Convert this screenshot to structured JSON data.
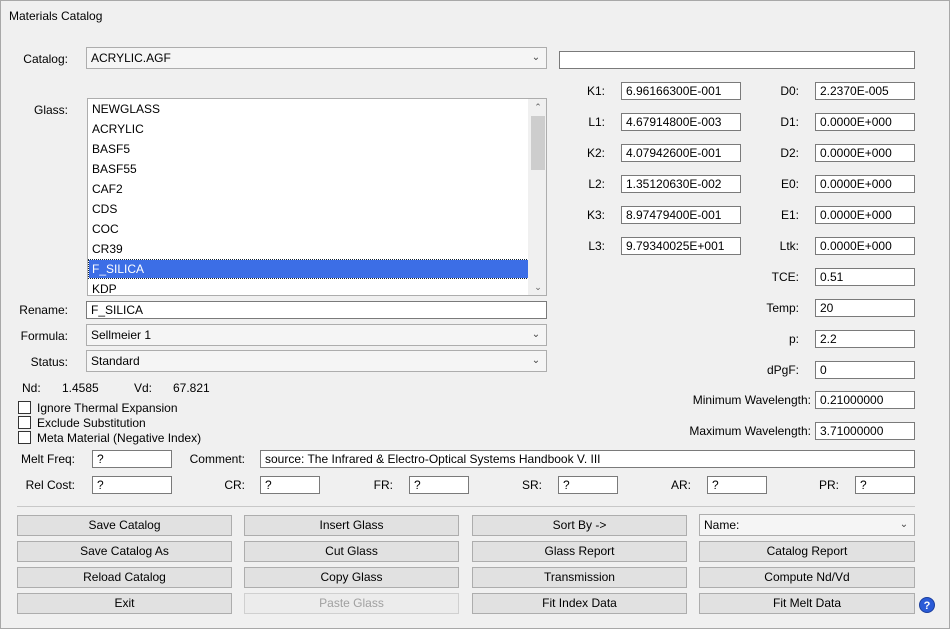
{
  "window": {
    "title": "Materials Catalog"
  },
  "catalog": {
    "label": "Catalog:",
    "value": "ACRYLIC.AGF",
    "extra_value": ""
  },
  "glass": {
    "label": "Glass:",
    "items": [
      "NEWGLASS",
      "ACRYLIC",
      "BASF5",
      "BASF55",
      "CAF2",
      "CDS",
      "COC",
      "CR39",
      "F_SILICA",
      "KDP"
    ],
    "selected": "F_SILICA"
  },
  "rename": {
    "label": "Rename:",
    "value": "F_SILICA"
  },
  "formula": {
    "label": "Formula:",
    "value": "Sellmeier 1"
  },
  "status": {
    "label": "Status:",
    "value": "Standard"
  },
  "indices": {
    "nd_label": "Nd:",
    "nd_value": "1.4585",
    "vd_label": "Vd:",
    "vd_value": "67.821"
  },
  "checkboxes": {
    "ignore_thermal": "Ignore Thermal Expansion",
    "exclude_sub": "Exclude Substitution",
    "meta_material": "Meta Material (Negative Index)"
  },
  "coefficients": {
    "k1": {
      "label": "K1:",
      "value": "6.96166300E-001"
    },
    "l1": {
      "label": "L1:",
      "value": "4.67914800E-003"
    },
    "k2": {
      "label": "K2:",
      "value": "4.07942600E-001"
    },
    "l2": {
      "label": "L2:",
      "value": "1.35120630E-002"
    },
    "k3": {
      "label": "K3:",
      "value": "8.97479400E-001"
    },
    "l3": {
      "label": "L3:",
      "value": "9.79340025E+001"
    }
  },
  "thermal": {
    "d0": {
      "label": "D0:",
      "value": "2.2370E-005"
    },
    "d1": {
      "label": "D1:",
      "value": "0.0000E+000"
    },
    "d2": {
      "label": "D2:",
      "value": "0.0000E+000"
    },
    "e0": {
      "label": "E0:",
      "value": "0.0000E+000"
    },
    "e1": {
      "label": "E1:",
      "value": "0.0000E+000"
    },
    "ltk": {
      "label": "Ltk:",
      "value": "0.0000E+000"
    },
    "tce": {
      "label": "TCE:",
      "value": "0.51"
    },
    "temp": {
      "label": "Temp:",
      "value": "20"
    },
    "p": {
      "label": "p:",
      "value": "2.2"
    },
    "dpgf": {
      "label": "dPgF:",
      "value": "0"
    }
  },
  "wavelength": {
    "min": {
      "label": "Minimum Wavelength:",
      "value": "0.21000000"
    },
    "max": {
      "label": "Maximum Wavelength:",
      "value": "3.71000000"
    }
  },
  "melt_freq": {
    "label": "Melt Freq:",
    "value": "?"
  },
  "comment": {
    "label": "Comment:",
    "value": "source:  The Infrared & Electro-Optical Systems Handbook V. III"
  },
  "costs": {
    "rel_cost": {
      "label": "Rel Cost:",
      "value": "?"
    },
    "cr": {
      "label": "CR:",
      "value": "?"
    },
    "fr": {
      "label": "FR:",
      "value": "?"
    },
    "sr": {
      "label": "SR:",
      "value": "?"
    },
    "ar": {
      "label": "AR:",
      "value": "?"
    },
    "pr": {
      "label": "PR:",
      "value": "?"
    }
  },
  "buttons": {
    "save_catalog": "Save Catalog",
    "save_catalog_as": "Save Catalog As",
    "reload_catalog": "Reload Catalog",
    "exit": "Exit",
    "insert_glass": "Insert Glass",
    "cut_glass": "Cut Glass",
    "copy_glass": "Copy Glass",
    "paste_glass": "Paste Glass",
    "sort_by": "Sort By ->",
    "glass_report": "Glass Report",
    "transmission": "Transmission",
    "fit_index_data": "Fit Index Data",
    "catalog_report": "Catalog Report",
    "compute_nd_vd": "Compute Nd/Vd",
    "fit_melt_data": "Fit Melt Data"
  },
  "sort": {
    "value": "Name:"
  },
  "icons": {
    "chevron": "chevron-down-icon",
    "help": "help-icon",
    "help_glyph": "?"
  }
}
